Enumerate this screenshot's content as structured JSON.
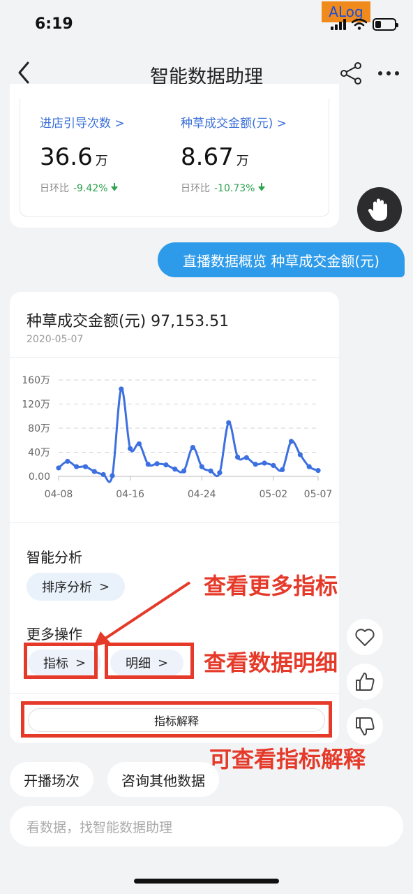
{
  "status": {
    "time": "6:19",
    "alog": "ALog"
  },
  "nav": {
    "title": "智能数据助理"
  },
  "metrics": [
    {
      "label": "进店引导次数",
      "chevron": ">",
      "value": "36.6",
      "unit": "万",
      "change_label": "日环比",
      "change": "-9.42%"
    },
    {
      "label": "种草成交金额(元)",
      "chevron": ">",
      "value": "8.67",
      "unit": "万",
      "change_label": "日环比",
      "change": "-10.73%"
    }
  ],
  "user_message": "直播数据概览 种草成交金额(元)",
  "chart_card": {
    "title": "种草成交金额(元) 97,153.51",
    "date": "2020-05-07"
  },
  "chart_data": {
    "type": "line",
    "x_ticks": [
      "04-08",
      "04-16",
      "04-24",
      "05-02",
      "05-07"
    ],
    "y_ticks": [
      "0.00",
      "40万",
      "80万",
      "120万",
      "160万"
    ],
    "ylim": [
      0,
      160
    ],
    "grid": true,
    "series": [
      {
        "values": [
          14,
          25,
          16,
          16,
          8,
          3,
          1,
          145,
          46,
          54,
          20,
          21,
          19,
          12,
          9,
          48,
          16,
          9,
          6,
          89,
          32,
          31,
          20,
          22,
          18,
          11,
          58,
          36,
          16,
          9.7
        ]
      }
    ],
    "color": "#3c6fe0"
  },
  "analysis": {
    "title": "智能分析",
    "sort_button": "排序分析",
    "chevron": ">"
  },
  "more_ops": {
    "title": "更多操作",
    "metric_button": "指标",
    "detail_button": "明细",
    "chevron": ">"
  },
  "explain_button": "指标解释",
  "annotations": {
    "more_metrics": "查看更多指标",
    "data_detail": "查看数据明细",
    "explain": "可查看指标解释"
  },
  "chips": [
    "开播场次",
    "咨询其他数据"
  ],
  "input": {
    "placeholder": "看数据，找智能数据助理"
  },
  "icons": [
    "back-icon",
    "share-icon",
    "more-icon",
    "hand-stop-icon",
    "heart-icon",
    "thumbs-up-icon",
    "thumbs-down-icon",
    "arrow-down-icon"
  ]
}
